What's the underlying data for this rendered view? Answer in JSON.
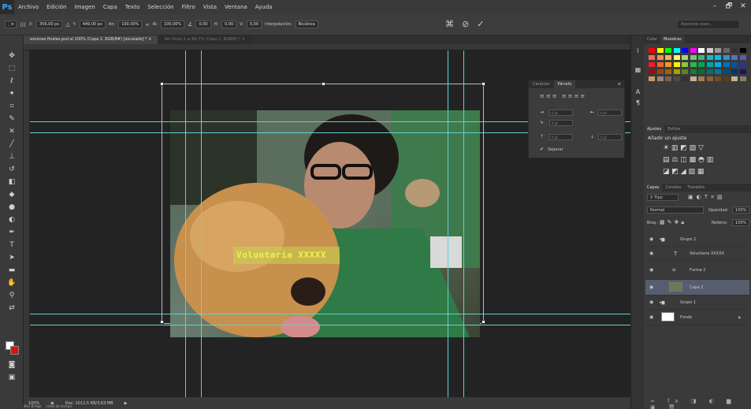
{
  "app": {
    "logo": "Ps"
  },
  "menu": [
    "Archivo",
    "Edición",
    "Imagen",
    "Capa",
    "Texto",
    "Selección",
    "Filtro",
    "Vista",
    "Ventana",
    "Ayuda"
  ],
  "window_controls": [
    "–",
    "🗗",
    "✕"
  ],
  "options": {
    "x_label": "X:",
    "x_value": "356,00 px",
    "y_label": "Y:",
    "y_value": "449,00 px",
    "an_label": "An:",
    "an_value": "100,00%",
    "al_label": "Al:",
    "al_value": "100,00%",
    "angle_value": "0,00",
    "h_label": "H:",
    "h_value": "0,00",
    "v_label": "V:",
    "v_value": "0,00",
    "interp_label": "Interpolación:",
    "interp_value": "Bicúbica",
    "cancel_icon": "⊘",
    "commit_icon": "✓",
    "search_placeholder": "Aspectos esen..."
  },
  "tabs": [
    {
      "label": "escenas finales.psd al 100% (Capa 2, RGB/8#) [escalado] * ×",
      "active": true
    },
    {
      "label": "Sin título-1 al 66,7% (Capa 1, RGB/8) * ×",
      "active": false
    }
  ],
  "canvas": {
    "banner_text": "Voluntaria XXXXX"
  },
  "paragraph_panel": {
    "tabs": [
      "Carácter",
      "Párrafo"
    ],
    "fields": [
      "0 pt",
      "0 pt",
      "0 pt",
      "0 pt",
      "0 pt"
    ],
    "hyphen_label": "Separar"
  },
  "status": {
    "zoom": "100%",
    "doc": "Doc: 1012,5 KB/3,63 MB"
  },
  "bottom_tabs": [
    "Mini Bridge",
    "Línea de tiempo"
  ],
  "right_panel": {
    "color_tabs": [
      "Color",
      "Muestras"
    ],
    "adjust_tabs": [
      "Ajustes",
      "Estilos"
    ],
    "adjust_title": "Añadir un ajuste",
    "layers_tabs": [
      "Capas",
      "Canales",
      "Trazados"
    ],
    "filter_label": "Tipo",
    "blend_mode": "Normal",
    "opacity_label": "Opacidad:",
    "opacity_value": "100%",
    "lock_label": "Bloq.:",
    "fill_label": "Relleno:",
    "fill_value": "100%",
    "layers": [
      {
        "name": "Grupo 2",
        "kind": "group"
      },
      {
        "name": "Voluntaria XXXXX",
        "kind": "text"
      },
      {
        "name": "Forma 2",
        "kind": "shape"
      },
      {
        "name": "Capa 2",
        "kind": "pixel",
        "selected": true
      },
      {
        "name": "Grupo 1",
        "kind": "group"
      },
      {
        "name": "Fondo",
        "kind": "background"
      }
    ]
  }
}
